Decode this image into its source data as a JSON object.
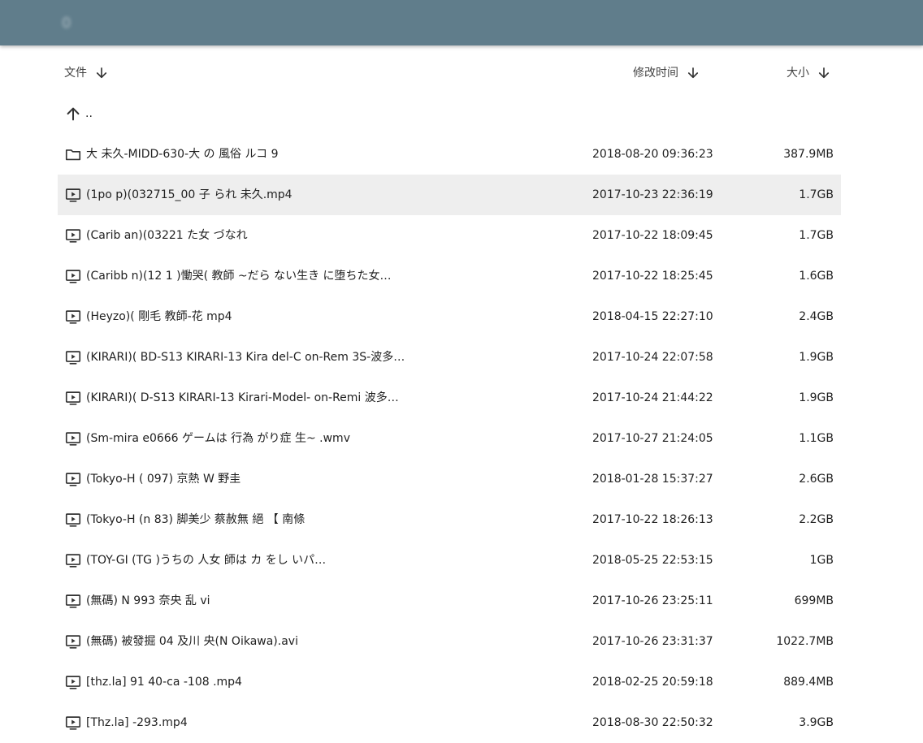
{
  "app": {
    "title": "0"
  },
  "header": {
    "name_label": "文件",
    "time_label": "修改时间",
    "size_label": "大小"
  },
  "parent": {
    "label": ".."
  },
  "files": [
    {
      "type": "folder",
      "name": "大 未久-MIDD-630-大 の 風俗 ルコ 9 ",
      "time": "2018-08-20 09:36:23",
      "size": "387.9MB"
    },
    {
      "type": "video",
      "name": "(1po p)(032715_00 子 られ 未久.mp4",
      "time": "2017-10-23 22:36:19",
      "size": "1.7GB",
      "selected": true
    },
    {
      "type": "video",
      "name": "(Carib an)(03221 た女 づなれ",
      "time": "2017-10-22 18:09:45",
      "size": "1.7GB"
    },
    {
      "type": "video",
      "name": "(Caribb n)(12 1 )慟哭( 教師 ~だら ない生き に堕ちた女…",
      "time": "2017-10-22 18:25:45",
      "size": "1.6GB"
    },
    {
      "type": "video",
      "name": "(Heyzo)( 剛毛 教師-花 mp4",
      "time": "2018-04-15 22:27:10",
      "size": "2.4GB"
    },
    {
      "type": "video",
      "name": "(KIRARI)( BD-S13 KIRARI-13 Kira del-C on-Rem 3S-波多…",
      "time": "2017-10-24 22:07:58",
      "size": "1.9GB"
    },
    {
      "type": "video",
      "name": "(KIRARI)( D-S13 KIRARI-13 Kirari-Model- on-Remi 波多…",
      "time": "2017-10-24 21:44:22",
      "size": "1.9GB"
    },
    {
      "type": "video",
      "name": "(Sm-mira e0666 ゲームは 行為 がり症 生~ .wmv",
      "time": "2017-10-27 21:24:05",
      "size": "1.1GB"
    },
    {
      "type": "video",
      "name": "(Tokyo-H ( 097) 京熱 W 野圭",
      "time": "2018-01-28 15:37:27",
      "size": "2.6GB"
    },
    {
      "type": "video",
      "name": "(Tokyo-H (n 83) 脚美少 蔡赦無 絕 【 南條",
      "time": "2017-10-22 18:26:13",
      "size": "2.2GB"
    },
    {
      "type": "video",
      "name": "(TOY-GI (TG )うちの 人女 師は カ をし いパ…",
      "time": "2018-05-25 22:53:15",
      "size": "1GB"
    },
    {
      "type": "video",
      "name": "(無碼) N 993 奈央 乱 vi",
      "time": "2017-10-26 23:25:11",
      "size": "699MB"
    },
    {
      "type": "video",
      "name": "(無碼) 被發掘 04 及川 央(N Oikawa).avi",
      "time": "2017-10-26 23:31:37",
      "size": "1022.7MB"
    },
    {
      "type": "video",
      "name": "[thz.la] 91 40-ca -108 .mp4",
      "time": "2018-02-25 20:59:18",
      "size": "889.4MB"
    },
    {
      "type": "video",
      "name": "[Thz.la] -293.mp4",
      "time": "2018-08-30 22:50:32",
      "size": "3.9GB"
    }
  ]
}
